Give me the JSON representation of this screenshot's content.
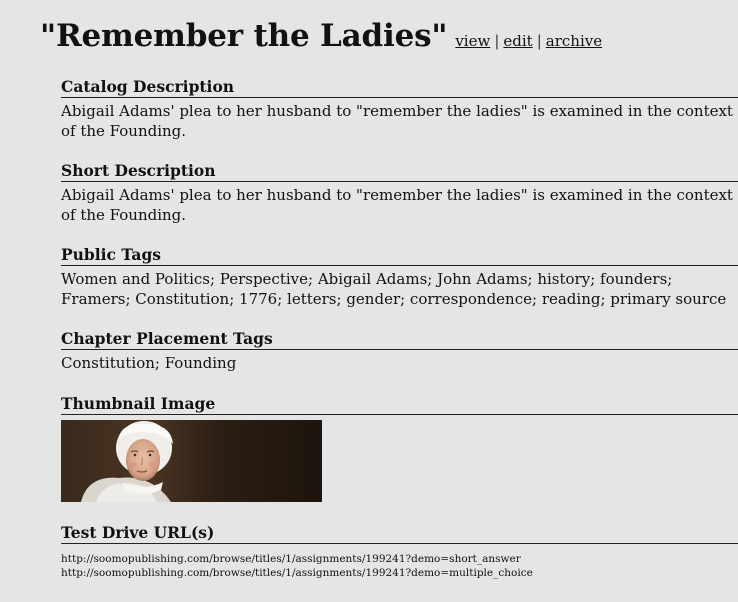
{
  "header": {
    "title": "\"Remember the Ladies\"",
    "actions": [
      {
        "label": "view"
      },
      {
        "label": "edit"
      },
      {
        "label": "archive"
      }
    ],
    "separator": "|"
  },
  "sections": {
    "catalog": {
      "heading": "Catalog Description",
      "text": "Abigail Adams' plea to her husband to \"remember the ladies\" is examined in the context of the Founding."
    },
    "short": {
      "heading": "Short Description",
      "text": "Abigail Adams' plea to her husband to \"remember the ladies\" is examined in the context of the Founding."
    },
    "public_tags": {
      "heading": "Public Tags",
      "text": "Women and Politics; Perspective; Abigail Adams; John Adams; history; founders; Framers; Constitution; 1776; letters; gender; correspondence; reading; primary source"
    },
    "chapter_tags": {
      "heading": "Chapter Placement Tags",
      "text": "Constitution; Founding"
    },
    "thumbnail": {
      "heading": "Thumbnail Image"
    },
    "test_drive": {
      "heading": "Test Drive URL(s)",
      "urls": [
        "http://soomopublishing.com/browse/titles/1/assignments/199241?demo=short_answer",
        "http://soomopublishing.com/browse/titles/1/assignments/199241?demo=multiple_choice"
      ]
    }
  }
}
